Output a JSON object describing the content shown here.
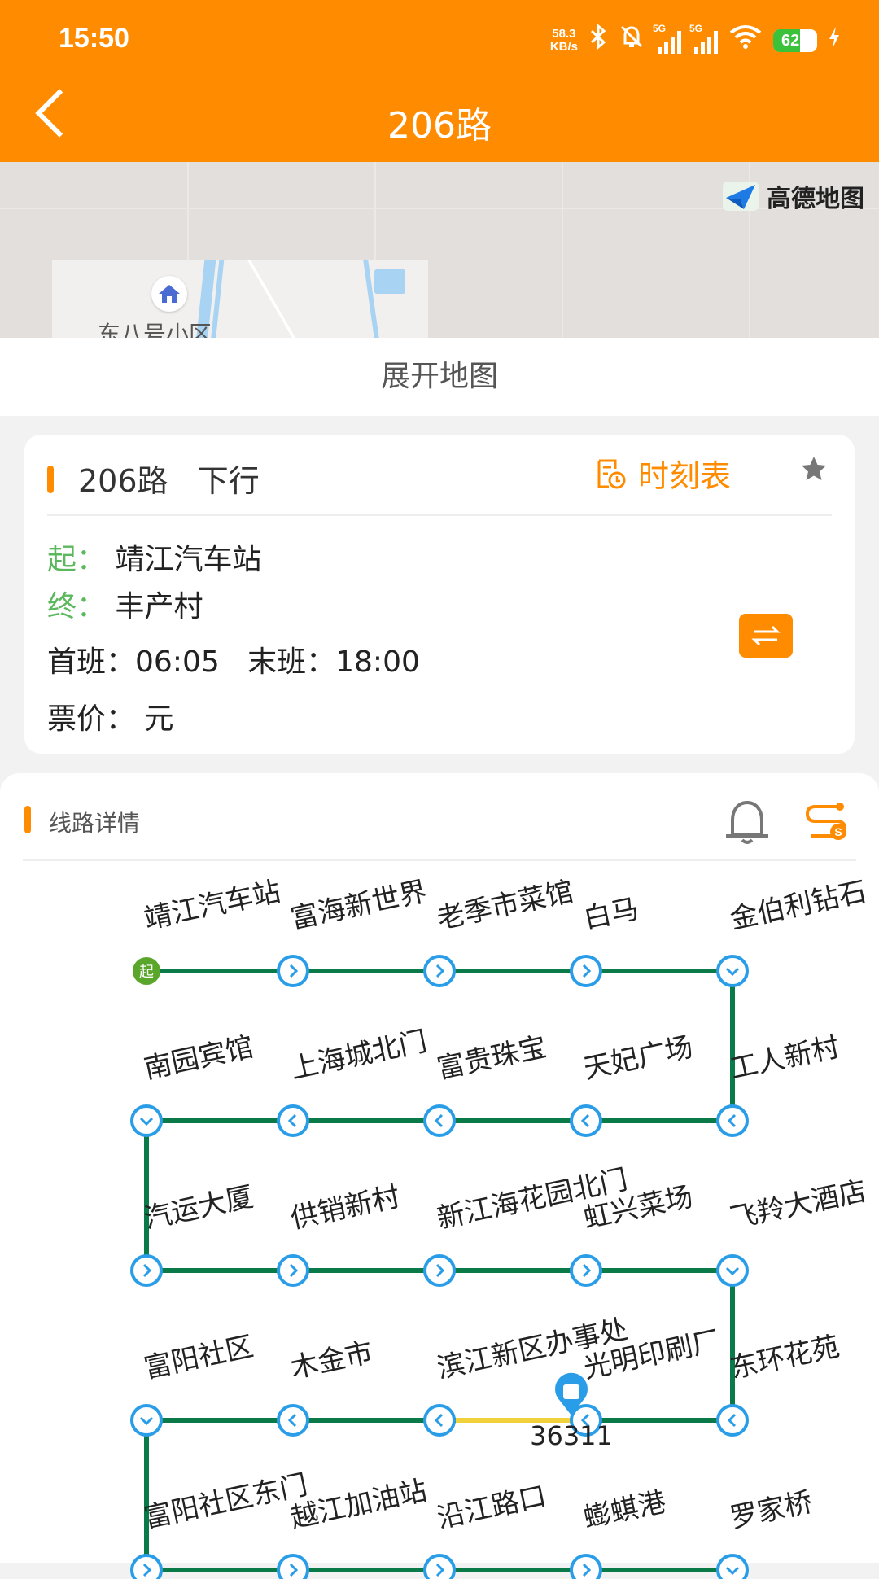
{
  "status_bar": {
    "time": "15:50",
    "net_speed_value": "58.3",
    "net_speed_unit": "KB/s",
    "sim1": "5G",
    "sim2": "5G",
    "battery": "62",
    "battery_level": 62,
    "icons": [
      "bluetooth-icon",
      "mute-icon",
      "signal-icon",
      "signal-icon",
      "wifi-icon",
      "battery-icon",
      "charging-icon"
    ]
  },
  "header": {
    "title": "206路",
    "back_icon": "chevron-left-icon"
  },
  "map": {
    "poi_label": "东八号小区",
    "logo_text": "高德地图",
    "expand_label": "展开地图"
  },
  "line_card": {
    "name": "206路",
    "direction": "下行",
    "timetable_label": "时刻表",
    "start_label": "起：",
    "start_station": "靖江汽车站",
    "end_label": "终：",
    "end_station": "丰产村",
    "first_bus_label": "首班：",
    "first_bus_time": "06:05",
    "last_bus_label": "末班：",
    "last_bus_time": "18:00",
    "fare_label": "票价：",
    "fare_value": "元",
    "accent_color": "#ff8c00",
    "green_color": "#5bb85d"
  },
  "route_detail": {
    "title": "线路详情",
    "start_badge": "起",
    "bus_id": "36311",
    "line_color": "#0a7a48",
    "highlight_color": "#f2d23c",
    "marker_color": "#2a9de8",
    "rows": [
      {
        "direction": "right",
        "stations": [
          "靖江汽车站",
          "富海新世界",
          "老季市菜馆",
          "白马",
          "金伯利钻石"
        ]
      },
      {
        "direction": "left",
        "stations": [
          "南园宾馆",
          "上海城北门",
          "富贵珠宝",
          "天妃广场",
          "工人新村"
        ]
      },
      {
        "direction": "right",
        "stations": [
          "汽运大厦",
          "供销新村",
          "新江海花园北门",
          "虹兴菜场",
          "飞羚大酒店"
        ]
      },
      {
        "direction": "left",
        "stations": [
          "富阳社区",
          "木金市",
          "滨江新区办事处",
          "光明印刷厂",
          "东环花苑"
        ]
      },
      {
        "direction": "right",
        "stations": [
          "富阳社区东门",
          "越江加油站",
          "沿江路口",
          "蟛蜞港",
          "罗家桥"
        ]
      }
    ]
  }
}
